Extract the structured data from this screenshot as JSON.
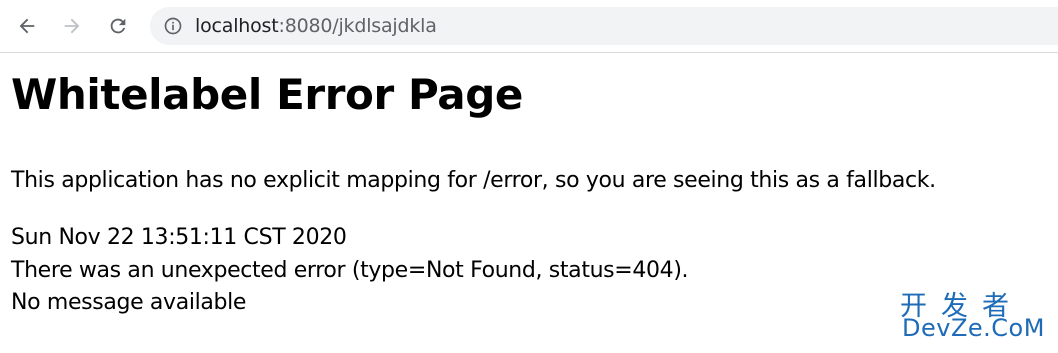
{
  "browser": {
    "url_host": "localhost",
    "url_rest": ":8080/jkdlsajdkla",
    "icons": [
      "back-arrow-icon",
      "forward-arrow-icon",
      "reload-icon",
      "info-icon"
    ]
  },
  "page": {
    "title": "Whitelabel Error Page",
    "explanation": "This application has no explicit mapping for /error, so you are seeing this as a fallback.",
    "timestamp": "Sun Nov 22 13:51:11 CST 2020",
    "error_line": "There was an unexpected error (type=Not Found, status=404).",
    "message": "No message available"
  },
  "watermark": {
    "cn": "开发者",
    "en": "DevZe.CoM"
  },
  "colors": {
    "text": "#000000",
    "toolbar_icon": "#5f6368",
    "forward_disabled": "#bdc1c6",
    "address_bar_bg": "#f1f3f4",
    "watermark": "#1e6bb8"
  }
}
